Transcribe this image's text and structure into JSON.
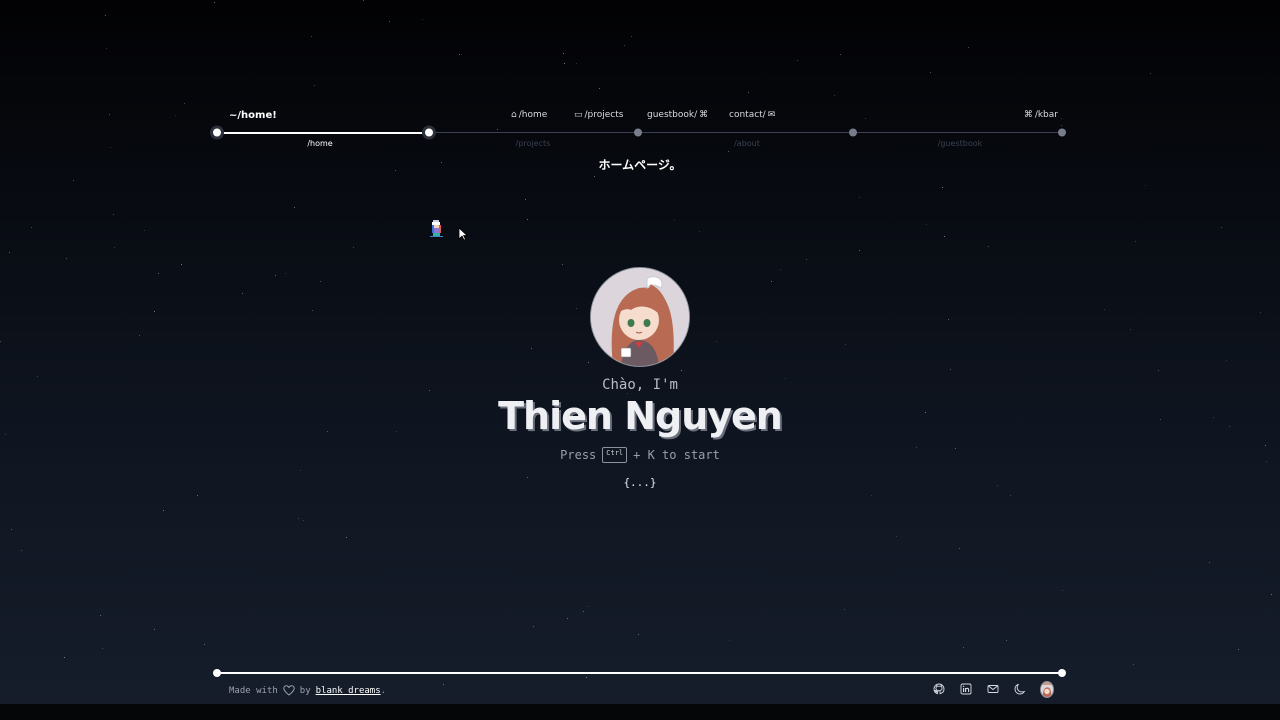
{
  "header": {
    "brand": "~/home!",
    "nav": [
      {
        "icon": "⌂",
        "label": "/home",
        "icon_first": true,
        "name": "nav-home",
        "icon_name": "home-icon"
      },
      {
        "icon": "▭",
        "label": "/projects",
        "icon_first": true,
        "name": "nav-projects",
        "icon_name": "folder-icon"
      },
      {
        "icon": "⌘",
        "label": "guestbook/",
        "icon_first": false,
        "name": "nav-guestbook",
        "icon_name": "command-icon"
      },
      {
        "icon": "✉",
        "label": "contact/",
        "icon_first": false,
        "name": "nav-contact",
        "icon_name": "contact-card-icon"
      }
    ],
    "kbar": {
      "icon": "⌘",
      "label": "/kbar"
    }
  },
  "track": {
    "labels": [
      "/home",
      "/projects",
      "/about",
      "/guestbook"
    ],
    "progress": 0.25
  },
  "page_title": "ホームページ。",
  "hero": {
    "greeting": "Chào, I'm",
    "name": "Thien Nguyen",
    "hint_prefix": "Press",
    "hint_key": "Ctrl",
    "hint_suffix": "+ K to start",
    "ellipsis": "{...}"
  },
  "footer": {
    "made_with": "Made with",
    "by": "by",
    "author": "blank_dreams",
    "period": ".",
    "socials": [
      "github-icon",
      "linkedin-icon",
      "mail-icon",
      "moon-icon",
      "avatar"
    ]
  },
  "colors": {
    "accent": "#ffffff",
    "background_top": "#020204",
    "background_bottom": "#161d2b"
  }
}
